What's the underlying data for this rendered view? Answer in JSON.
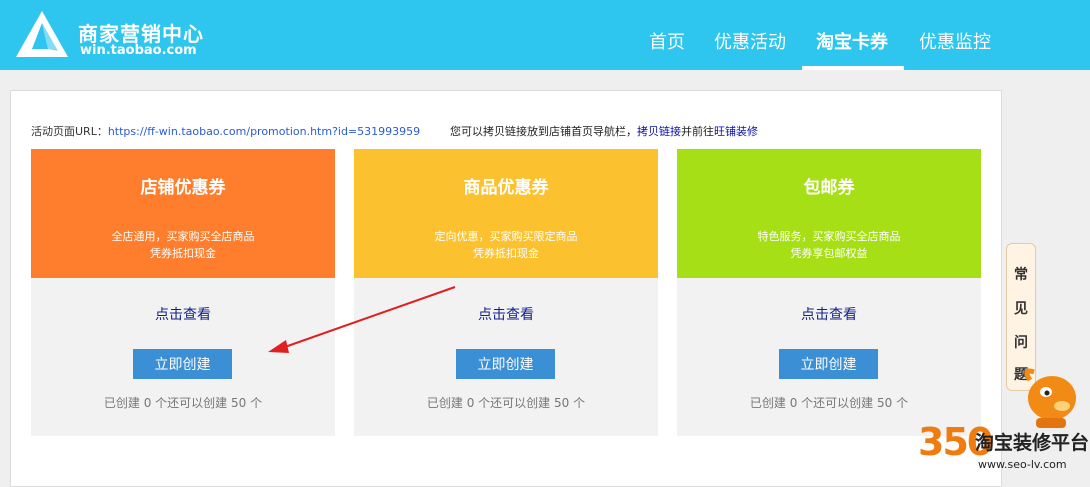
{
  "header": {
    "brand_title": "商家营销中心",
    "brand_url": "win.taobao.com",
    "nav": [
      {
        "label": "首页",
        "active": false
      },
      {
        "label": "优惠活动",
        "active": false
      },
      {
        "label": "淘宝卡券",
        "active": true
      },
      {
        "label": "优惠监控",
        "active": false
      }
    ]
  },
  "activity": {
    "url_label": "活动页面URL：",
    "url": "https://ff-win.taobao.com/promotion.htm?id=531993959",
    "hint_prefix": "您可以拷贝链接放到店铺首页导航栏，",
    "hint_link1": "拷贝链接",
    "hint_middle": "并前往",
    "hint_link2": "旺铺装修"
  },
  "cards": [
    {
      "title": "店铺优惠券",
      "desc1": "全店通用，买家购买全店商品",
      "desc2": "凭券抵扣现金",
      "color": "#ff7e2d",
      "view": "点击查看",
      "button": "立即创建",
      "count": "已创建 0 个还可以创建 50 个"
    },
    {
      "title": "商品优惠券",
      "desc1": "定向优惠，买家购买限定商品",
      "desc2": "凭券抵扣现金",
      "color": "#fcc12f",
      "view": "点击查看",
      "button": "立即创建",
      "count": "已创建 0 个还可以创建 50 个"
    },
    {
      "title": "包邮券",
      "desc1": "特色服务，买家购买全店商品",
      "desc2": "凭券享包邮权益",
      "color": "#a6df16",
      "view": "点击查看",
      "button": "立即创建",
      "count": "已创建 0 个还可以创建 50 个"
    }
  ],
  "faq": {
    "chars": [
      "常",
      "见",
      "问",
      "题"
    ]
  },
  "watermark": {
    "number": "350",
    "name": "淘宝装修平台",
    "url": "www.seo-lv.com"
  },
  "colors": {
    "header": "#2ec5ef",
    "button": "#3b8fd4",
    "arrow": "#e02020"
  }
}
